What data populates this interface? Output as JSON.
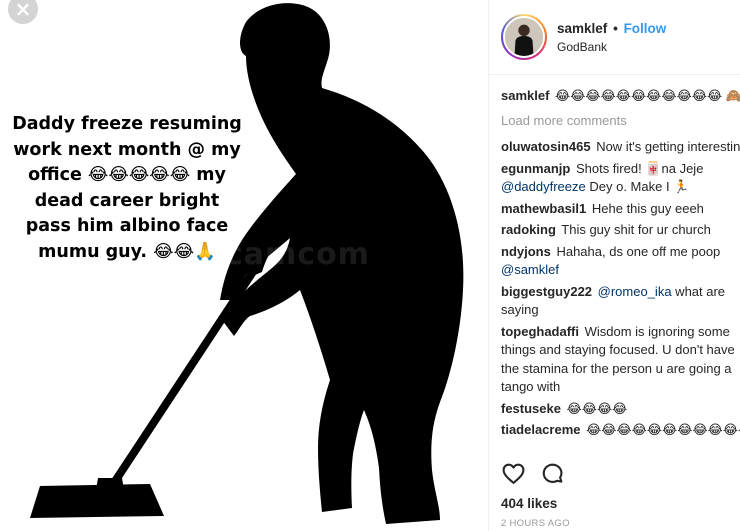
{
  "post": {
    "overlay_caption": "Daddy freeze resuming work next month @ my office 😂😂😂😂😂 my dead career bright pass him albino face mumu guy. 😂😂🙏",
    "watermark": "camcom",
    "close_glyph": "×"
  },
  "header": {
    "username": "samklef",
    "separator": "•",
    "follow_label": "Follow",
    "location": "GodBank"
  },
  "comments": {
    "caption": {
      "user": "samklef",
      "text": "😂😂😂😂😂😂😂😂😂😂😂 🙈"
    },
    "load_more": "Load more comments",
    "items": [
      {
        "user": "oluwatosin465",
        "pre": " Now it's getting interesting",
        "mention": "",
        "post": ""
      },
      {
        "user": "egunmanjp",
        "pre": " Shots fired! 🀄na Jeje ",
        "mention": "@daddyfreeze",
        "post": " Dey o. Make I 🏃"
      },
      {
        "user": "mathewbasil1",
        "pre": " Hehe this guy eeeh",
        "mention": "",
        "post": ""
      },
      {
        "user": "radoking",
        "pre": " This guy shit for ur church",
        "mention": "",
        "post": ""
      },
      {
        "user": "ndyjons",
        "pre": " Hahaha, ds one off me poop ",
        "mention": "@samklef",
        "post": ""
      },
      {
        "user": "biggestguy222",
        "pre": " ",
        "mention": "@romeo_ika",
        "post": " what are saying"
      },
      {
        "user": "topeghadaffi",
        "pre": " Wisdom is ignoring some things and staying focused. U don't have the stamina for the person u are going a tango with",
        "mention": "",
        "post": ""
      },
      {
        "user": "festuseke",
        "pre": " 😂😂😂😂",
        "mention": "",
        "post": ""
      },
      {
        "user": "tiadelacreme",
        "pre": " 😂😂😂😂😂😂😂😂😂😂😂😂",
        "mention": "",
        "post": ""
      }
    ]
  },
  "actions": {
    "like_icon": "heart-icon",
    "comment_icon": "comment-bubble-icon",
    "likes": "404 likes",
    "timestamp": "2 HOURS AGO"
  },
  "colors": {
    "link": "#3897f0",
    "mention": "#003569",
    "muted": "#999999"
  }
}
